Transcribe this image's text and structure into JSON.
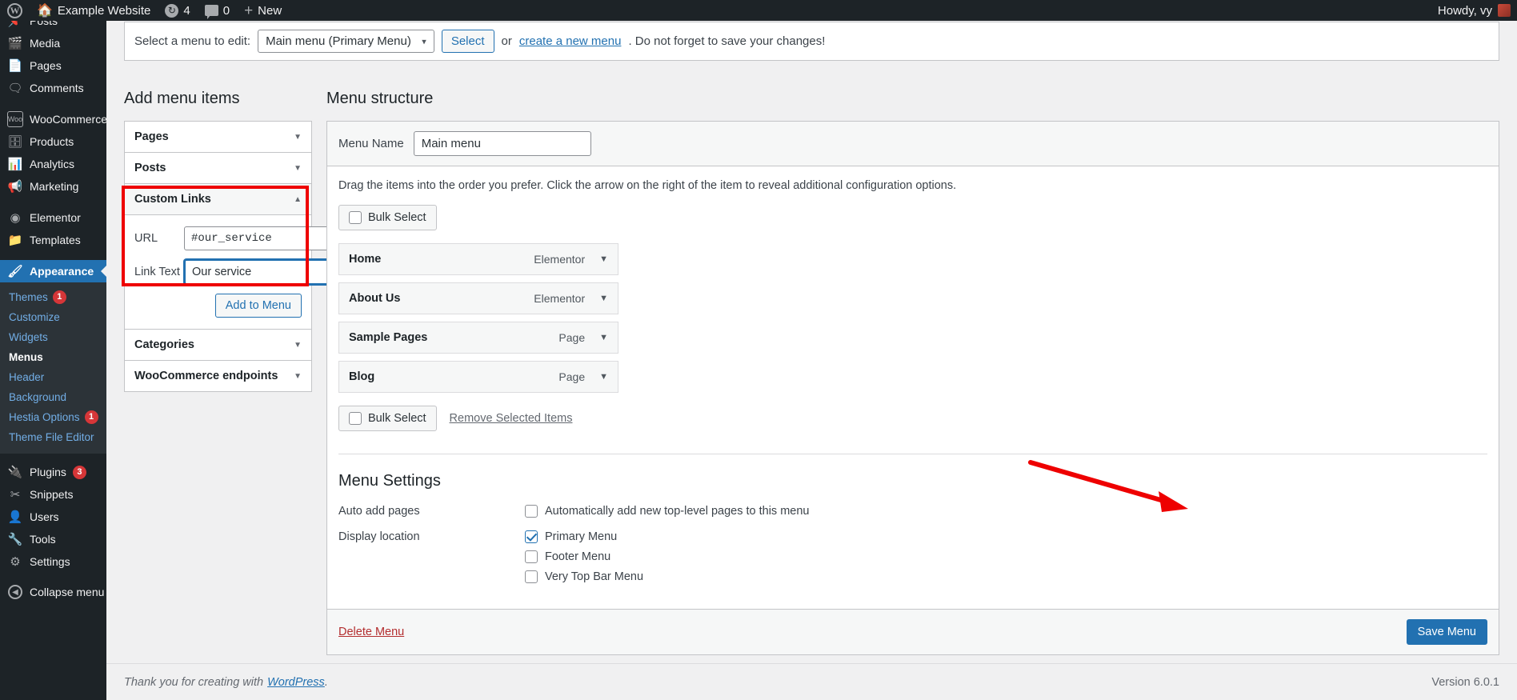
{
  "adminbar": {
    "logo_icon": "wordpress-logo-icon",
    "site_name": "Example Website",
    "home_icon": "home-icon",
    "updates_icon": "updates-icon",
    "updates_count": "4",
    "comments_icon": "comments-icon",
    "comments_count": "0",
    "new_icon": "plus-icon",
    "new_label": "New",
    "howdy": "Howdy, vy"
  },
  "sidebar": {
    "items": [
      {
        "label": "Posts",
        "icon": "pin-icon"
      },
      {
        "label": "Media",
        "icon": "media-icon"
      },
      {
        "label": "Pages",
        "icon": "pages-icon"
      },
      {
        "label": "Comments",
        "icon": "comments-icon"
      },
      {
        "label": "WooCommerce",
        "icon": "woocommerce-icon"
      },
      {
        "label": "Products",
        "icon": "products-icon"
      },
      {
        "label": "Analytics",
        "icon": "analytics-icon"
      },
      {
        "label": "Marketing",
        "icon": "marketing-icon"
      },
      {
        "label": "Elementor",
        "icon": "elementor-icon"
      },
      {
        "label": "Templates",
        "icon": "templates-icon"
      },
      {
        "label": "Appearance",
        "icon": "appearance-icon"
      },
      {
        "label": "Plugins",
        "icon": "plugins-icon",
        "count": "3"
      },
      {
        "label": "Snippets",
        "icon": "snippets-icon"
      },
      {
        "label": "Users",
        "icon": "users-icon"
      },
      {
        "label": "Tools",
        "icon": "tools-icon"
      },
      {
        "label": "Settings",
        "icon": "settings-icon"
      },
      {
        "label": "Collapse menu",
        "icon": "collapse-icon"
      }
    ],
    "appearance_submenu": [
      {
        "label": "Themes",
        "count": "1"
      },
      {
        "label": "Customize"
      },
      {
        "label": "Widgets"
      },
      {
        "label": "Menus",
        "active": true
      },
      {
        "label": "Header"
      },
      {
        "label": "Background"
      },
      {
        "label": "Hestia Options",
        "count": "1"
      },
      {
        "label": "Theme File Editor"
      }
    ]
  },
  "menu_select": {
    "label": "Select a menu to edit:",
    "selected": "Main menu (Primary Menu)",
    "caret_icon": "chevron-down-icon",
    "select_button": "Select",
    "or_text": "or",
    "create_link": "create a new menu",
    "trailing_text": ". Do not forget to save your changes!"
  },
  "add_menu_items": {
    "title": "Add menu items",
    "sections": [
      {
        "label": "Pages",
        "open": false,
        "arrow_icon": "chevron-down-icon"
      },
      {
        "label": "Posts",
        "open": false,
        "arrow_icon": "chevron-down-icon"
      },
      {
        "label": "Custom Links",
        "open": true,
        "arrow_icon": "chevron-up-icon"
      },
      {
        "label": "Categories",
        "open": false,
        "arrow_icon": "chevron-down-icon"
      },
      {
        "label": "WooCommerce endpoints",
        "open": false,
        "arrow_icon": "chevron-down-icon"
      }
    ],
    "custom_links": {
      "url_label": "URL",
      "url_value": "#our_service",
      "link_text_label": "Link Text",
      "link_text_value": "Our service",
      "add_button": "Add to Menu"
    }
  },
  "menu_structure": {
    "title": "Menu structure",
    "menu_name_label": "Menu Name",
    "menu_name_value": "Main menu",
    "help_text": "Drag the items into the order you prefer. Click the arrow on the right of the item to reveal additional configuration options.",
    "bulk_select_top": "Bulk Select",
    "bulk_select_bottom": "Bulk Select",
    "remove_selected": "Remove Selected Items",
    "items": [
      {
        "name": "Home",
        "type": "Elementor",
        "arrow_icon": "chevron-down-icon"
      },
      {
        "name": "About Us",
        "type": "Elementor",
        "arrow_icon": "chevron-down-icon"
      },
      {
        "name": "Sample Pages",
        "type": "Page",
        "arrow_icon": "chevron-down-icon"
      },
      {
        "name": "Blog",
        "type": "Page",
        "arrow_icon": "chevron-down-icon"
      }
    ],
    "settings": {
      "title": "Menu Settings",
      "auto_add_label": "Auto add pages",
      "auto_add_option": "Automatically add new top-level pages to this menu",
      "auto_add_checked": false,
      "display_location_label": "Display location",
      "locations": [
        {
          "label": "Primary Menu",
          "checked": true
        },
        {
          "label": "Footer Menu",
          "checked": false
        },
        {
          "label": "Very Top Bar Menu",
          "checked": false
        }
      ]
    },
    "delete_menu": "Delete Menu",
    "save_menu": "Save Menu"
  },
  "footer": {
    "thanks_prefix": "Thank you for creating with",
    "wordpress_link": "WordPress",
    "thanks_suffix": ".",
    "version": "Version 6.0.1"
  },
  "annotations": {
    "highlight_color": "#ee0000",
    "arrow_color": "#ee0000"
  }
}
